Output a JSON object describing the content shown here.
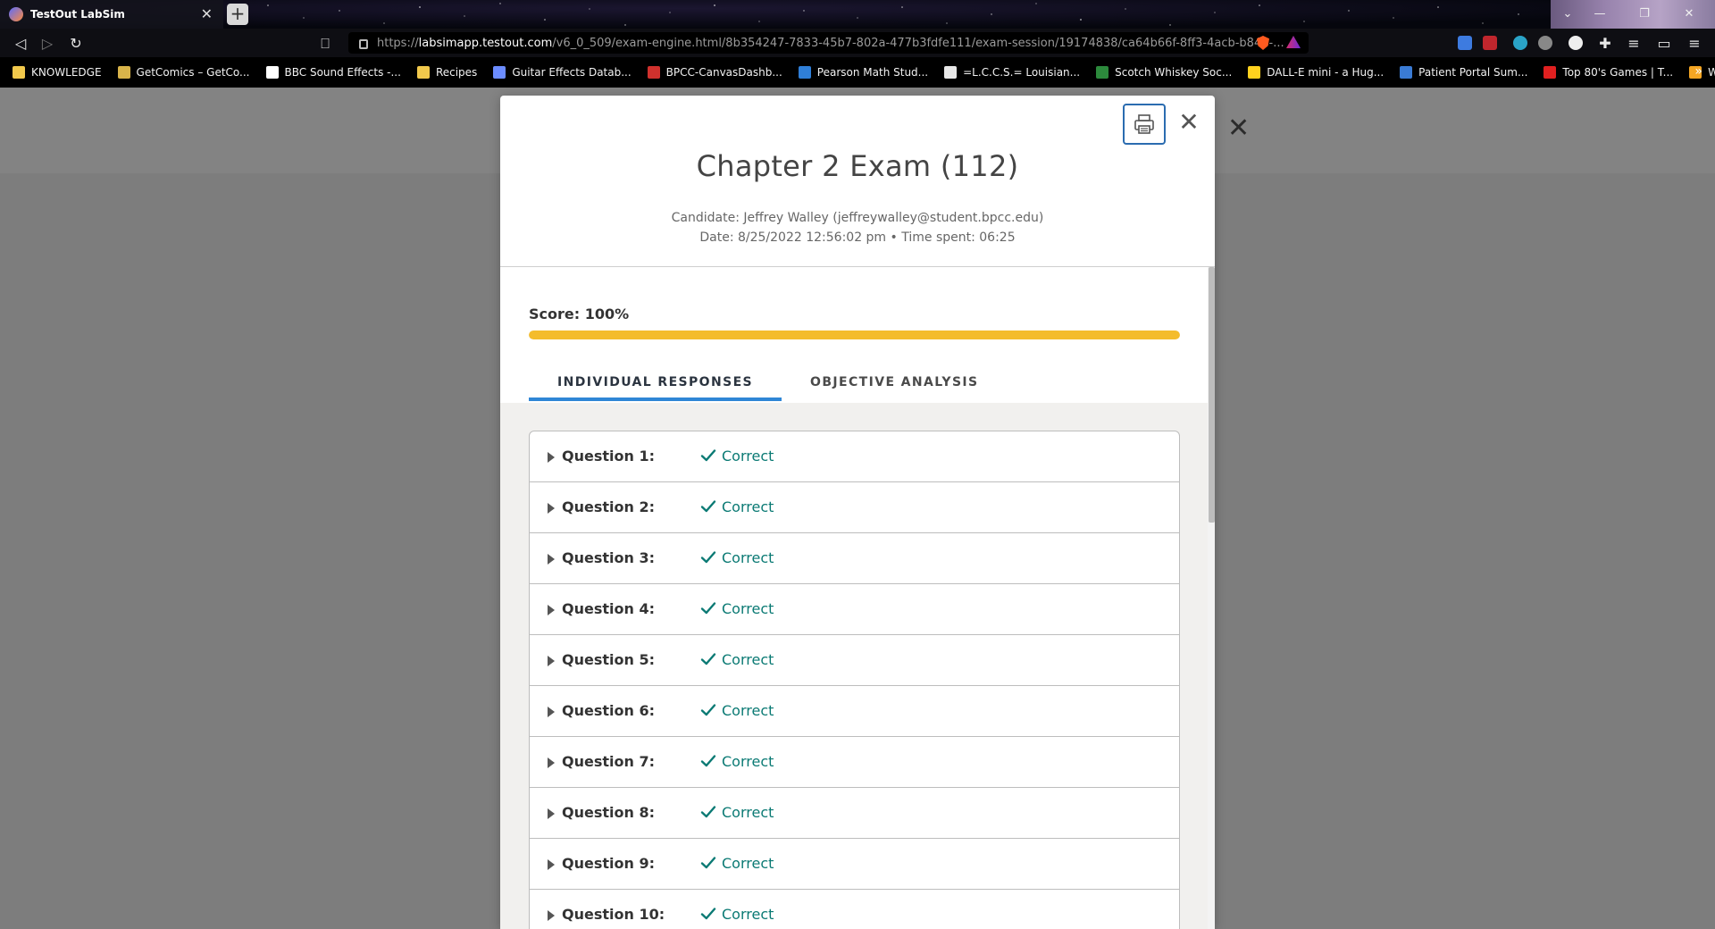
{
  "browser": {
    "tab_title": "TestOut LabSim",
    "new_tab_symbol": "+",
    "url_scheme": "https://",
    "url_host": "labsimapp.testout.com",
    "url_path": "/v6_0_509/exam-engine.html/8b354247-7833-45b7-802a-477b3fdfe111/exam-session/19174838/ca64b66f-8ff3-4acb-b844-...",
    "bookmarks": [
      {
        "label": "KNOWLEDGE",
        "color": "#f2c94c"
      },
      {
        "label": "GetComics – GetCo...",
        "color": "#d9b44a"
      },
      {
        "label": "BBC Sound Effects -...",
        "color": "#ffffff"
      },
      {
        "label": "Recipes",
        "color": "#f2c94c"
      },
      {
        "label": "Guitar Effects Datab...",
        "color": "#6b8cff"
      },
      {
        "label": "BPCC-CanvasDashb...",
        "color": "#d0312d"
      },
      {
        "label": "Pearson Math Stud...",
        "color": "#2f7fd8"
      },
      {
        "label": "=L.C.C.S.= Louisian...",
        "color": "#e8e8e8"
      },
      {
        "label": "Scotch Whiskey Soc...",
        "color": "#2c8a3c"
      },
      {
        "label": "DALL-E mini - a Hug...",
        "color": "#ffd21e"
      },
      {
        "label": "Patient Portal Sum...",
        "color": "#3a7bd5"
      },
      {
        "label": "Top 80's Games | T...",
        "color": "#e02020"
      },
      {
        "label": "Workday wholefoo...",
        "color": "#f5a623"
      }
    ],
    "bookmarks_more": "»"
  },
  "modal": {
    "title": "Chapter 2 Exam (112)",
    "candidate_line": "Candidate: Jeffrey Walley  (jeffreywalley@student.bpcc.edu)",
    "date_line": "Date: 8/25/2022 12:56:02 pm • Time spent: 06:25",
    "score_label": "Score: 100%",
    "score_fraction": 1.0,
    "tabs": [
      {
        "label": "INDIVIDUAL RESPONSES",
        "active": true
      },
      {
        "label": "OBJECTIVE ANALYSIS",
        "active": false
      }
    ],
    "questions": [
      {
        "label": "Question 1:",
        "status": "Correct"
      },
      {
        "label": "Question 2:",
        "status": "Correct"
      },
      {
        "label": "Question 3:",
        "status": "Correct"
      },
      {
        "label": "Question 4:",
        "status": "Correct"
      },
      {
        "label": "Question 5:",
        "status": "Correct"
      },
      {
        "label": "Question 6:",
        "status": "Correct"
      },
      {
        "label": "Question 7:",
        "status": "Correct"
      },
      {
        "label": "Question 8:",
        "status": "Correct"
      },
      {
        "label": "Question 9:",
        "status": "Correct"
      },
      {
        "label": "Question 10:",
        "status": "Correct"
      }
    ]
  },
  "colors": {
    "progress": "#f4bc2c",
    "active_tab_underline": "#2f86d6",
    "correct": "#0b7a74",
    "print_border": "#2b6cb0"
  }
}
